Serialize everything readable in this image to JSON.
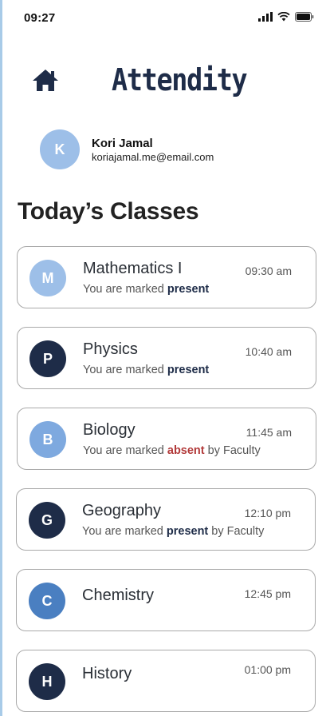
{
  "status_bar": {
    "time": "09:27"
  },
  "header": {
    "title": "Attendity",
    "home_icon": "home-icon"
  },
  "user": {
    "initial": "K",
    "name": "Kori Jamal",
    "email": "koriajamal.me@email.com"
  },
  "section_title": "Today’s Classes",
  "colors": {
    "navy": "#1e2c48",
    "light_blue": "#9dbfe8",
    "absent_red": "#b23a3a"
  },
  "classes": [
    {
      "initial": "M",
      "name": "Mathematics I",
      "time": "09:30 am",
      "prefix": "You are marked ",
      "status": "present",
      "suffix": ""
    },
    {
      "initial": "P",
      "name": "Physics",
      "time": "10:40 am",
      "prefix": "You are marked ",
      "status": "present",
      "suffix": ""
    },
    {
      "initial": "B",
      "name": "Biology",
      "time": "11:45 am",
      "prefix": "You are marked ",
      "status": "absent",
      "suffix": " by Faculty"
    },
    {
      "initial": "G",
      "name": "Geography",
      "time": "12:10 pm",
      "prefix": "You are marked ",
      "status": "present",
      "suffix": " by Faculty"
    },
    {
      "initial": "C",
      "name": "Chemistry",
      "time": "12:45 pm"
    },
    {
      "initial": "H",
      "name": "History",
      "time": "01:00 pm"
    }
  ]
}
